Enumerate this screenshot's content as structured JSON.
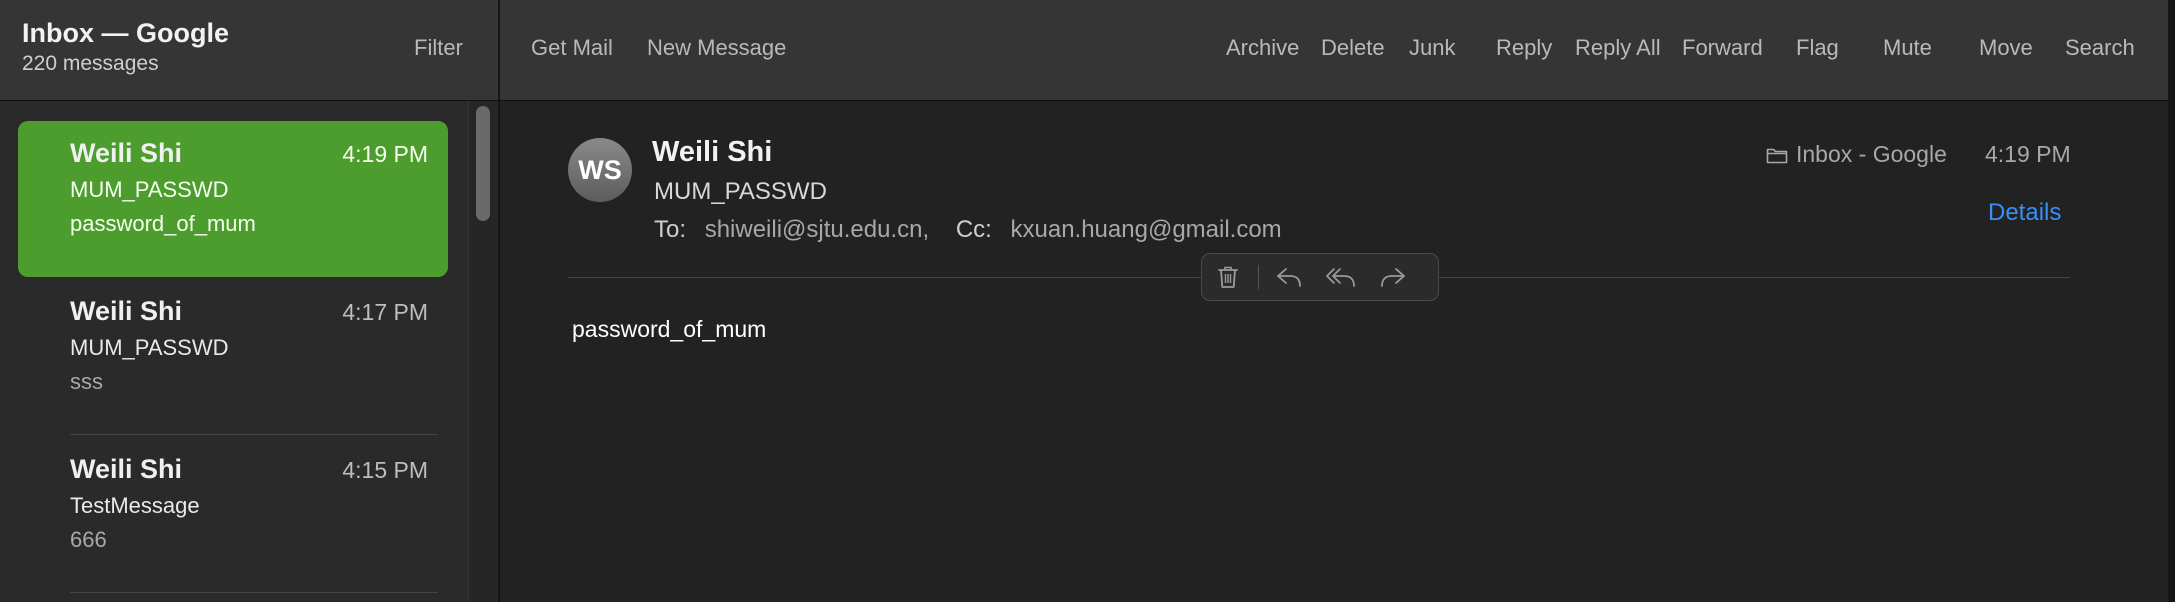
{
  "sidebar": {
    "mailbox_title": "Inbox — Google",
    "message_count": "220 messages",
    "filter_label": "Filter"
  },
  "toolbar": {
    "get_mail": "Get Mail",
    "new_message": "New Message",
    "archive": "Archive",
    "delete": "Delete",
    "junk": "Junk",
    "reply": "Reply",
    "reply_all": "Reply All",
    "forward": "Forward",
    "flag": "Flag",
    "mute": "Mute",
    "move": "Move",
    "search": "Search"
  },
  "messages": [
    {
      "sender": "Weili Shi",
      "time": "4:19 PM",
      "subject": "MUM_PASSWD",
      "preview": "password_of_mum",
      "selected": true
    },
    {
      "sender": "Weili Shi",
      "time": "4:17 PM",
      "subject": "MUM_PASSWD",
      "preview": "sss",
      "selected": false
    },
    {
      "sender": "Weili Shi",
      "time": "4:15 PM",
      "subject": "TestMessage",
      "preview": "666",
      "selected": false
    }
  ],
  "reader": {
    "avatar_initials": "WS",
    "sender": "Weili Shi",
    "subject": "MUM_PASSWD",
    "to_label": "To:",
    "to_address": "shiweili@sjtu.edu.cn,",
    "cc_label": "Cc:",
    "cc_address": "kxuan.huang@gmail.com",
    "mailbox": "Inbox - Google",
    "time": "4:19 PM",
    "details_link": "Details",
    "body": "password_of_mum"
  },
  "colors": {
    "selected_row": "#4d9d2e",
    "link": "#3a8ef5",
    "toolbar_bg": "#353535"
  },
  "icons": {
    "mailbox": "folder-icon",
    "float_bar": [
      "trash-icon",
      "reply-icon",
      "reply-all-icon",
      "forward-icon"
    ]
  }
}
